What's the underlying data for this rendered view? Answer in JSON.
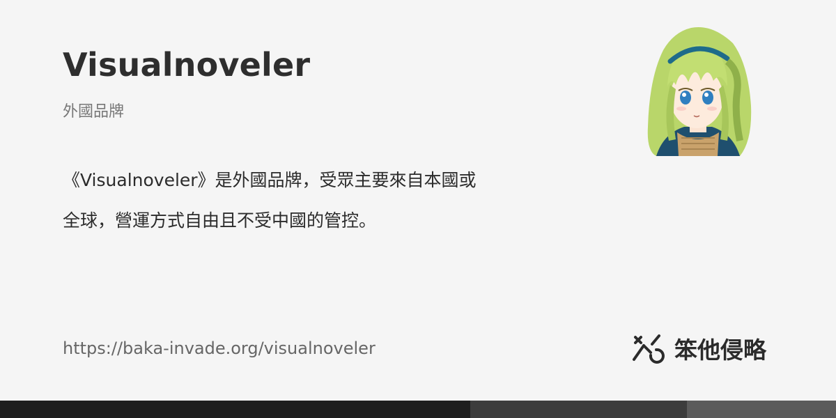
{
  "page": {
    "title": "Visualnoveler",
    "subtitle": "外國品牌",
    "description_line1": "《Visualnoveler》是外國品牌，受眾主要來自本國或",
    "description_line2": "全球，營運方式自由且不受中國的管控。",
    "url": "https://baka-invade.org/visualnoveler"
  },
  "brand": {
    "name": "笨他侵略",
    "logo_icon": "stylized-chart-cursor-icon"
  },
  "avatar": {
    "icon": "anime-girl-avatar"
  },
  "colors": {
    "background": "#f5f5f5",
    "title": "#2e2e2e",
    "muted": "#777777",
    "footer_dark": "#1e1e1e",
    "footer_mid": "#3c3c3c",
    "footer_light": "#5b5b5b",
    "hair": "#b9d66a",
    "hair_shadow": "#8fb04a",
    "headband": "#1e6b8a"
  }
}
